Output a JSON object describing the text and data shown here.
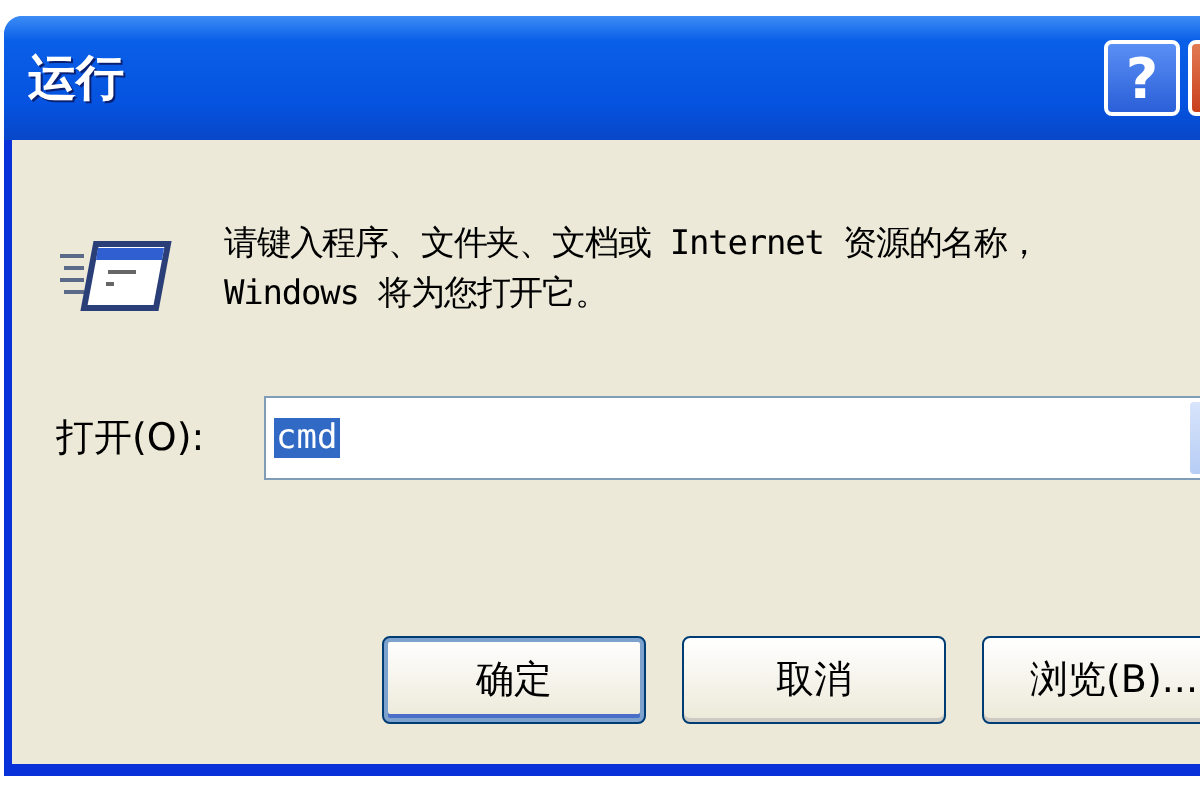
{
  "window": {
    "title": "运行",
    "help_button": "?"
  },
  "prompt": "请键入程序、文件夹、文档或 Internet 资源的名称，Windows 将为您打开它。",
  "open_field": {
    "label": "打开(O):",
    "value": "cmd",
    "value_selected": true
  },
  "buttons": [
    {
      "label": "确定",
      "default": true
    },
    {
      "label": "取消",
      "default": false
    },
    {
      "label": "浏览(B)...",
      "default": false
    }
  ]
}
